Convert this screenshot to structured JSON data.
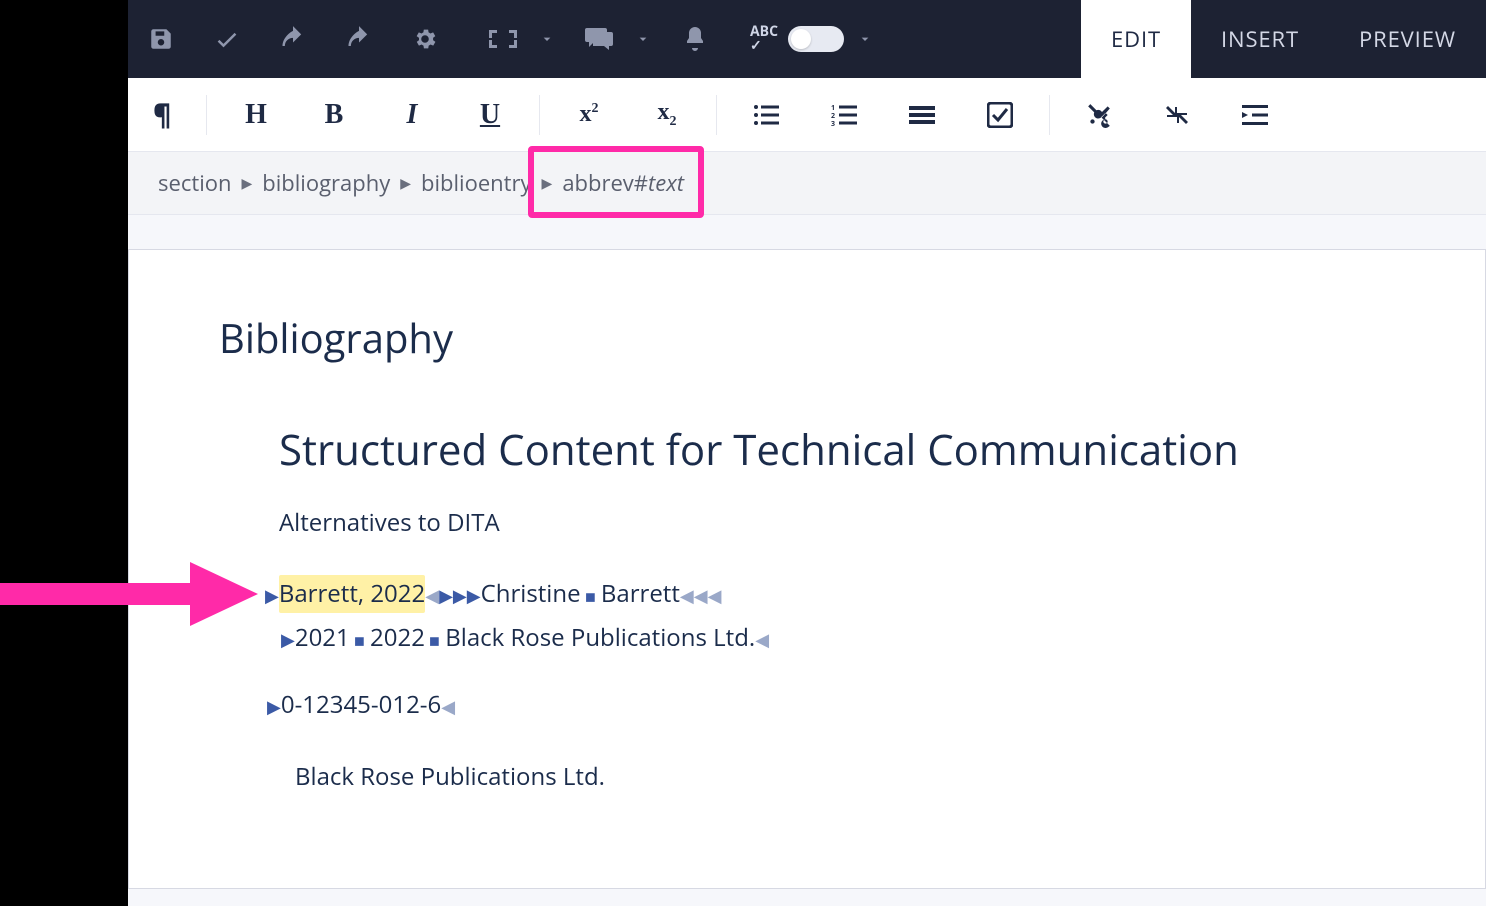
{
  "colors": {
    "accent_highlight": "#ff2aa8",
    "toolbar_bg": "#1d2233",
    "text_primary": "#1b2c4b",
    "highlight_bg": "#fff1a6"
  },
  "toolbar": {
    "tabs": {
      "edit": "EDIT",
      "insert": "INSERT",
      "preview": "PREVIEW"
    }
  },
  "breadcrumb": {
    "items": [
      "section",
      "bibliography",
      "biblioentry"
    ],
    "last_prefix": "abbrev#",
    "last_em": "text"
  },
  "doc": {
    "h1": "Bibliography",
    "h2": "Structured Content for Technical Communication",
    "subtitle": "Alternatives to DITA",
    "entry": {
      "abbrev": "Barrett, 2022",
      "firstname": "Christine",
      "surname": "Barrett",
      "year1": "2021",
      "year2": "2022",
      "publisher_inline": "Black Rose Publications Ltd.",
      "isbn": "0-12345-012-6",
      "publisher_block": "Black Rose Publications Ltd."
    }
  }
}
